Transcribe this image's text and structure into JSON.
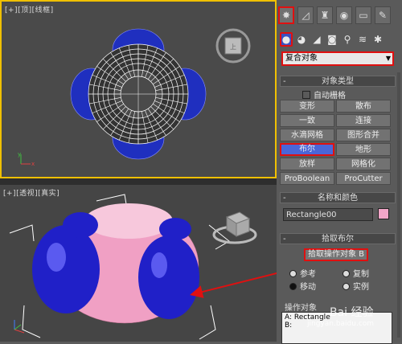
{
  "viewports": {
    "top": {
      "label": "[+][顶][线框]"
    },
    "perspective": {
      "label": "[+][透视][真实]"
    }
  },
  "command_panel": {
    "tabs": [
      {
        "icon": "create-icon",
        "glyph": "✸",
        "active": true
      },
      {
        "icon": "modify-icon",
        "glyph": "◿",
        "active": false
      },
      {
        "icon": "hierarchy-icon",
        "glyph": "♜",
        "active": false
      },
      {
        "icon": "motion-icon",
        "glyph": "◉",
        "active": false
      },
      {
        "icon": "display-icon",
        "glyph": "▭",
        "active": false
      },
      {
        "icon": "utilities-icon",
        "glyph": "✎",
        "active": false
      }
    ],
    "subtabs": [
      {
        "icon": "geometry-icon",
        "glyph": "●",
        "active": true
      },
      {
        "icon": "shapes-icon",
        "glyph": "◕",
        "active": false
      },
      {
        "icon": "lights-icon",
        "glyph": "◢",
        "active": false
      },
      {
        "icon": "cameras-icon",
        "glyph": "◙",
        "active": false
      },
      {
        "icon": "helpers-icon",
        "glyph": "⚲",
        "active": false
      },
      {
        "icon": "spacewarps-icon",
        "glyph": "≋",
        "active": false
      },
      {
        "icon": "systems-icon",
        "glyph": "✱",
        "active": false
      }
    ],
    "category_dropdown": {
      "value": "复合对象"
    },
    "object_type": {
      "header": "对象类型",
      "autogrid": "自动栅格",
      "buttons": [
        "变形",
        "散布",
        "一致",
        "连接",
        "水滴网格",
        "图形合并",
        "布尔",
        "地形",
        "放样",
        "网格化",
        "ProBoolean",
        "ProCutter"
      ]
    },
    "name_color": {
      "header": "名称和颜色",
      "name_value": "Rectangle00",
      "color": "#f2a6c8"
    },
    "pick_boolean": {
      "header": "拾取布尔",
      "pick_button": "拾取操作对象 B",
      "options": [
        "参考",
        "复制",
        "移动",
        "实例"
      ],
      "selected": "移动"
    },
    "operands": {
      "header": "操作对象",
      "items": [
        "A: Rectangle",
        "B:"
      ]
    }
  },
  "watermark": {
    "text": "Bai 经验",
    "url": "jingyan.baidu.com"
  },
  "colors": {
    "accent_red": "#e01010",
    "selected_blue": "#4a66d8",
    "viewport_border": "#f0c000",
    "object_pink": "#f2a6c8",
    "object_blue": "#2a2ad0"
  }
}
